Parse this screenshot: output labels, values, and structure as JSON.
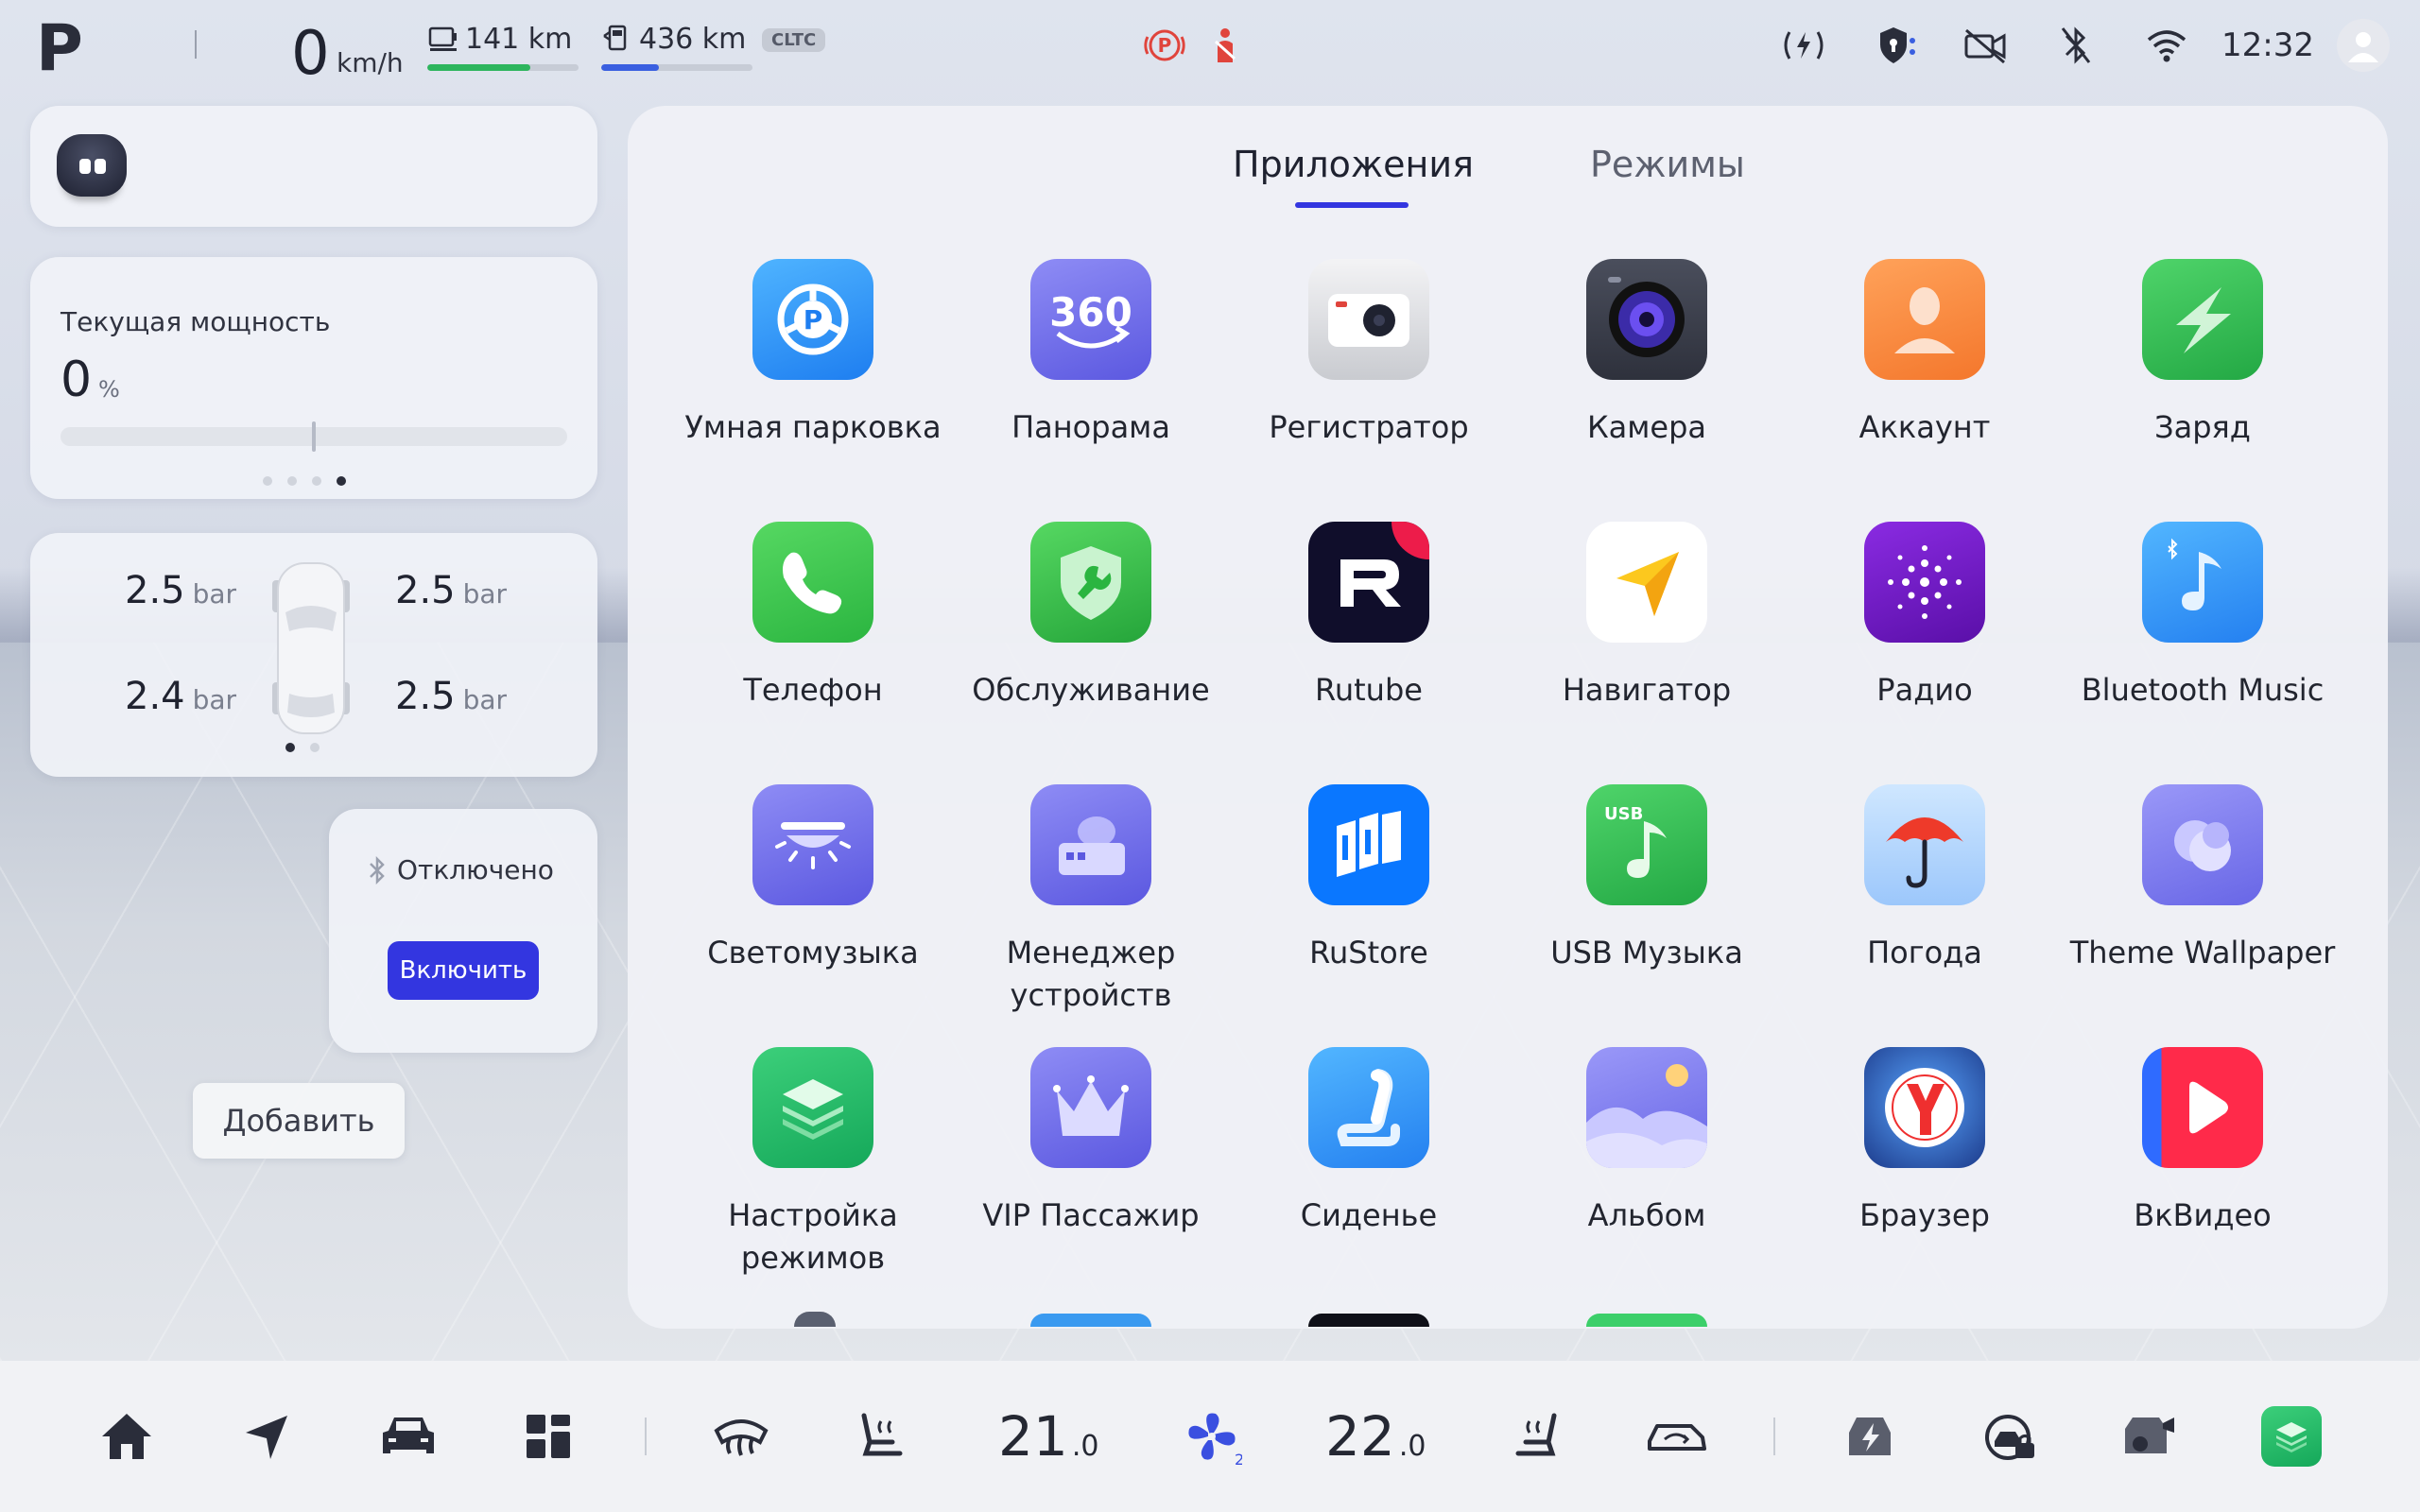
{
  "status": {
    "gear": "P",
    "speed": "0",
    "speed_unit": "km/h",
    "range_battery": "141 km",
    "range_battery_fraction": 0.68,
    "range_fuel": "436 km",
    "range_fuel_fraction": 0.38,
    "cycle_badge": "CLTC",
    "time": "12:32",
    "icons": [
      "parking-brake-icon",
      "seatbelt-warning-icon",
      "wireless-charging-icon",
      "security-icon",
      "camera-off-icon",
      "bluetooth-off-icon",
      "wifi-icon"
    ]
  },
  "power": {
    "label": "Текущая мощность",
    "value": "0",
    "unit": "%"
  },
  "tires": {
    "front_left": "2.5",
    "front_right": "2.5",
    "rear_left": "2.4",
    "rear_right": "2.5",
    "unit": "bar"
  },
  "bluetooth": {
    "status": "Отключено",
    "button": "Включить"
  },
  "add_button": "Добавить",
  "tabs": {
    "apps": "Приложения",
    "modes": "Режимы"
  },
  "apps": [
    {
      "name": "Умная парковка",
      "icon": "smart-parking-icon"
    },
    {
      "name": "Панорама",
      "icon": "panorama-360-icon"
    },
    {
      "name": "Регистратор",
      "icon": "dashcam-icon"
    },
    {
      "name": "Камера",
      "icon": "camera-icon"
    },
    {
      "name": "Аккаунт",
      "icon": "account-icon"
    },
    {
      "name": "Заряд",
      "icon": "charge-icon"
    },
    {
      "name": "Телефон",
      "icon": "phone-icon"
    },
    {
      "name": "Обслуживание",
      "icon": "service-icon"
    },
    {
      "name": "Rutube",
      "icon": "rutube-icon"
    },
    {
      "name": "Навигатор",
      "icon": "navigator-icon"
    },
    {
      "name": "Радио",
      "icon": "radio-icon"
    },
    {
      "name": "Bluetooth Music",
      "icon": "bluetooth-music-icon"
    },
    {
      "name": "Светомузыка",
      "icon": "light-music-icon"
    },
    {
      "name": "Менеджер устройств",
      "icon": "device-manager-icon"
    },
    {
      "name": "RuStore",
      "icon": "rustore-icon"
    },
    {
      "name": "USB Музыка",
      "icon": "usb-music-icon"
    },
    {
      "name": "Погода",
      "icon": "weather-icon"
    },
    {
      "name": "Theme Wallpaper",
      "icon": "theme-wallpaper-icon"
    },
    {
      "name": "Настройка режимов",
      "icon": "mode-settings-icon"
    },
    {
      "name": "VIP Пассажир",
      "icon": "vip-passenger-icon"
    },
    {
      "name": "Сиденье",
      "icon": "seat-icon"
    },
    {
      "name": "Альбом",
      "icon": "album-icon"
    },
    {
      "name": "Браузер",
      "icon": "browser-icon"
    },
    {
      "name": "ВкВидео",
      "icon": "vk-video-icon"
    }
  ],
  "dock": {
    "temp_left": "21",
    "temp_left_dec": ".0",
    "temp_right": "22",
    "temp_right_dec": ".0",
    "fan_level": "2",
    "icons": [
      "home-icon",
      "navigation-icon",
      "car-icon",
      "apps-grid-icon",
      "defrost-icon",
      "seat-heat-left-icon",
      "fan-icon",
      "seat-heat-right-icon",
      "car-recirculation-icon",
      "charge-station-icon",
      "car-care-icon",
      "car-camera-icon",
      "mode-settings-icon"
    ]
  },
  "colors": {
    "accent": "#3336e0",
    "battery_bar": "#2db55d",
    "fuel_bar": "#3a5fe0"
  }
}
